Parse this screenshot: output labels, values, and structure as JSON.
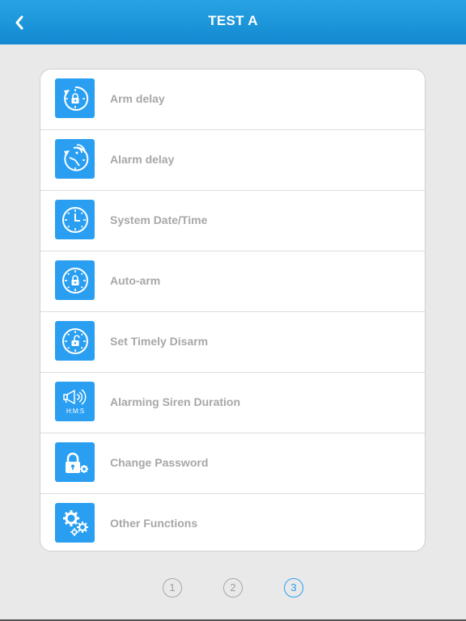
{
  "header": {
    "title": "TEST A",
    "back_icon": "chevron-left-icon",
    "colors": {
      "bar": "#1c95dc",
      "text": "#ffffff"
    }
  },
  "menu": {
    "items": [
      {
        "label": "Arm delay",
        "icon": "arm-delay-icon"
      },
      {
        "label": "Alarm delay",
        "icon": "alarm-delay-icon"
      },
      {
        "label": "System Date/Time",
        "icon": "clock-icon"
      },
      {
        "label": "Auto-arm",
        "icon": "auto-arm-icon"
      },
      {
        "label": "Set Timely Disarm",
        "icon": "timely-disarm-icon"
      },
      {
        "label": "Alarming Siren Duration",
        "icon": "siren-icon",
        "icon_text": "H:M:S"
      },
      {
        "label": "Change Password",
        "icon": "password-lock-icon"
      },
      {
        "label": "Other Functions",
        "icon": "gears-icon"
      }
    ],
    "colors": {
      "icon_bg": "#2a9ff2",
      "label": "#a7a7a7"
    }
  },
  "pager": {
    "pages": [
      "1",
      "2",
      "3"
    ],
    "current": "3",
    "colors": {
      "active": "#2a9ff2",
      "inactive": "#a8a8a8"
    }
  }
}
